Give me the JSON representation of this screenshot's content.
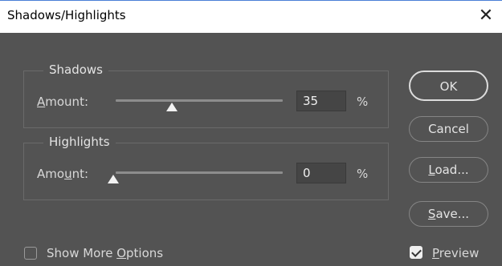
{
  "window": {
    "title": "Shadows/Highlights",
    "close_glyph": "✕"
  },
  "shadows": {
    "legend": "Shadows",
    "amount_label_pre": "",
    "amount_label_u": "A",
    "amount_label_post": "mount:",
    "value": "35",
    "unit": "%",
    "slider_fraction": 0.35
  },
  "highlights": {
    "legend": "Highlights",
    "amount_label_pre": "Amo",
    "amount_label_u": "u",
    "amount_label_post": "nt:",
    "value": "0",
    "unit": "%",
    "slider_fraction": 0
  },
  "buttons": {
    "ok": "OK",
    "cancel": "Cancel",
    "load_u": "L",
    "load_rest": "oad...",
    "save_u": "S",
    "save_rest": "ave..."
  },
  "show_more": {
    "pre": "Show More ",
    "u": "O",
    "post": "ptions",
    "checked": false
  },
  "preview": {
    "u": "P",
    "rest": "review",
    "checked": true
  }
}
